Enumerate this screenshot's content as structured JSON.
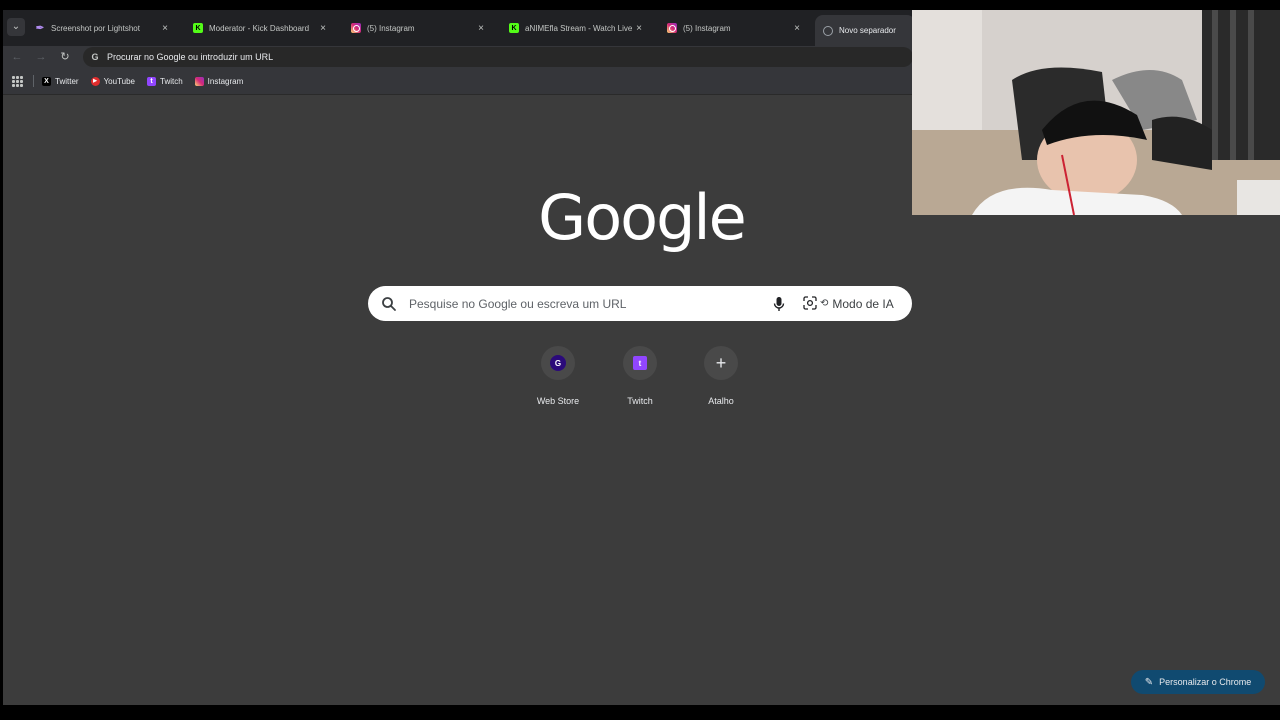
{
  "tabs": [
    {
      "title": "Screenshot por Lightshot",
      "icon": "lightshot-feather-icon",
      "close": "×"
    },
    {
      "title": "Moderator - Kick Dashboard",
      "icon": "kick-icon",
      "icon_glyph": "K",
      "close": "×"
    },
    {
      "title": "(5) Instagram",
      "icon": "instagram-icon",
      "close": "×"
    },
    {
      "title": "aNIMEfla Stream - Watch Live o",
      "icon": "kick-icon",
      "icon_glyph": "K",
      "close": "×"
    },
    {
      "title": "(5) Instagram",
      "icon": "instagram-icon",
      "close": "×"
    },
    {
      "title": "Novo separador",
      "icon": "chrome-globe-icon"
    }
  ],
  "toolbar": {
    "back": "←",
    "forward": "→",
    "reload": "↻",
    "omnibox_text": "Procurar no Google ou introduzir um URL"
  },
  "bookmarks": [
    {
      "label": "Twitter",
      "icon": "x-icon",
      "glyph": "X"
    },
    {
      "label": "YouTube",
      "icon": "youtube-icon",
      "glyph": "▶"
    },
    {
      "label": "Twitch",
      "icon": "twitch-icon",
      "glyph": "t"
    },
    {
      "label": "Instagram",
      "icon": "instagram-icon",
      "glyph": ""
    }
  ],
  "logo": "Google",
  "search": {
    "placeholder": "Pesquise no Google ou escreva um URL",
    "ai_mode_label": "Modo de IA"
  },
  "shortcuts": [
    {
      "label": "Web Store",
      "icon": "web-store-icon",
      "glyph": "G"
    },
    {
      "label": "Twitch",
      "icon": "twitch-icon",
      "glyph": "t"
    },
    {
      "label": "Atalho",
      "icon": "plus-icon",
      "glyph": "+"
    }
  ],
  "customize_label": "Personalizar o Chrome",
  "colors": {
    "page_bg": "#3c3c3c",
    "tabstrip_bg": "#202124",
    "customize_bg": "#104a70",
    "kick_green": "#53fc18",
    "twitch_purple": "#9146ff"
  }
}
